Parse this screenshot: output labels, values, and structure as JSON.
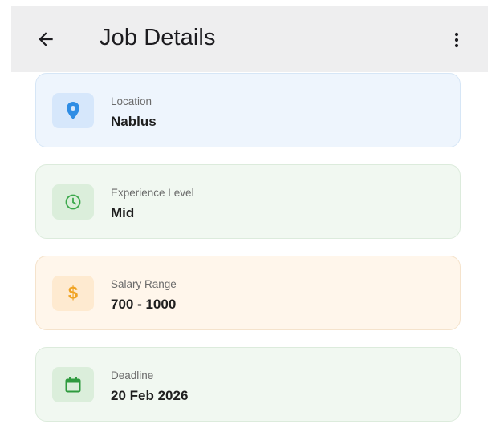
{
  "appbar": {
    "title": "Job Details",
    "back_icon": "arrow-back-icon",
    "menu_icon": "more-vert-icon"
  },
  "details": [
    {
      "label": "Location",
      "value": "Nablus",
      "icon": "location-pin-icon",
      "accent": "#2f8de4"
    },
    {
      "label": "Experience Level",
      "value": "Mid",
      "icon": "clock-icon",
      "accent": "#3aa84a"
    },
    {
      "label": "Salary Range",
      "value": "700 - 1000",
      "icon": "dollar-icon",
      "icon_glyph": "$",
      "accent": "#f0a323"
    },
    {
      "label": "Deadline",
      "value": "20 Feb 2026",
      "icon": "calendar-icon",
      "accent": "#2e9a3e"
    }
  ]
}
